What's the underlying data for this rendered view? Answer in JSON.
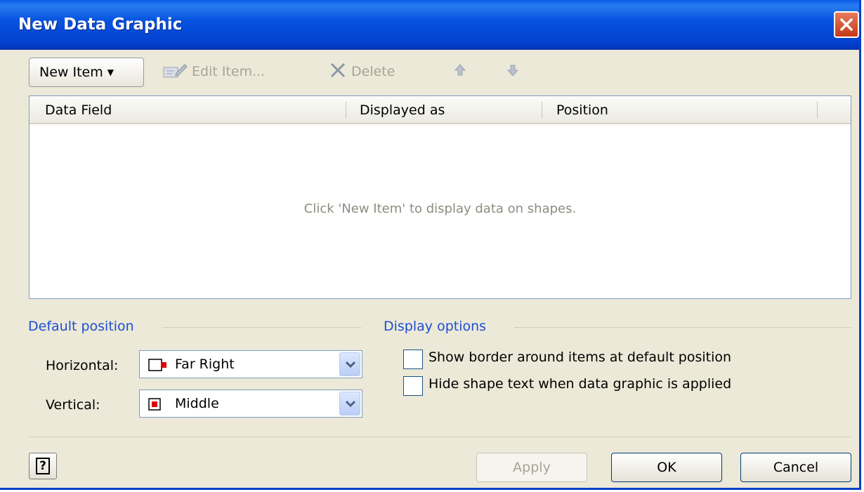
{
  "window": {
    "title": "New Data Graphic",
    "close_icon": "close-icon"
  },
  "toolbar": {
    "new_item_label": "New Item",
    "edit_item_label": "Edit Item...",
    "delete_label": "Delete",
    "move_up_icon": "up-arrow-icon",
    "move_down_icon": "down-arrow-icon"
  },
  "list": {
    "columns": [
      "Data Field",
      "Displayed as",
      "Position"
    ],
    "empty_message": "Click 'New Item' to display data on shapes."
  },
  "default_position": {
    "section_title": "Default position",
    "horizontal_label": "Horizontal:",
    "horizontal_value": "Far Right",
    "vertical_label": "Vertical:",
    "vertical_value": "Middle"
  },
  "display_options": {
    "section_title": "Display options",
    "options": [
      {
        "label": "Show border around items at default position",
        "checked": false
      },
      {
        "label": "Hide shape text when data graphic is applied",
        "checked": false
      }
    ]
  },
  "footer": {
    "apply_label": "Apply",
    "ok_label": "OK",
    "cancel_label": "Cancel",
    "help_glyph": "?"
  },
  "colors": {
    "title_bar": "#0a5ee8",
    "dialog_bg": "#ece9d8",
    "section_title": "#1d4ed4",
    "marker_red": "#e00000"
  }
}
